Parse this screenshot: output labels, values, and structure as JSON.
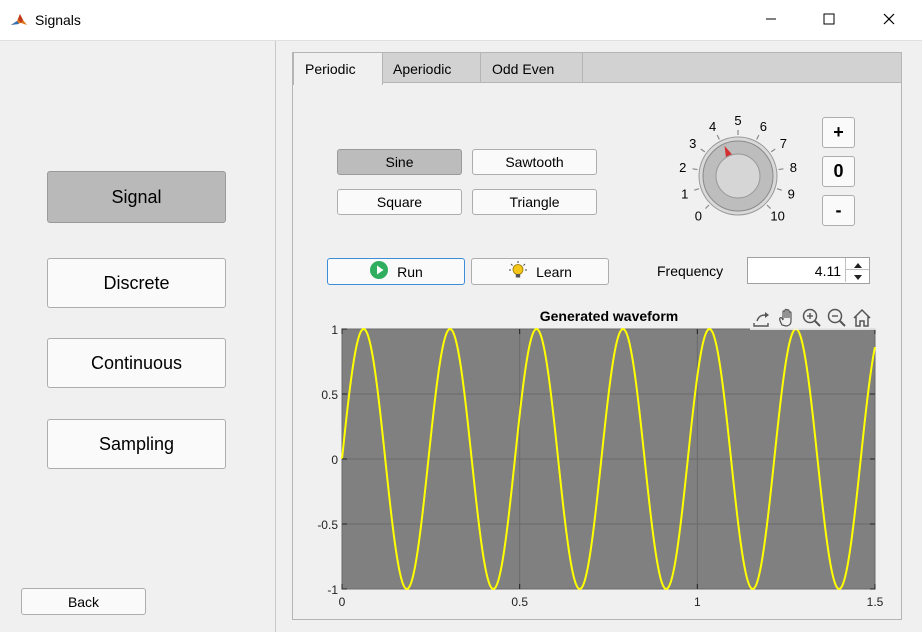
{
  "window": {
    "title": "Signals",
    "icon": "matlab-icon",
    "controls": [
      "minimize-icon",
      "maximize-icon",
      "close-icon"
    ]
  },
  "sidebar": {
    "items": [
      {
        "label": "Signal",
        "active": true
      },
      {
        "label": "Discrete",
        "active": false
      },
      {
        "label": "Continuous",
        "active": false
      },
      {
        "label": "Sampling",
        "active": false
      }
    ],
    "back_label": "Back"
  },
  "tabs": [
    {
      "label": "Periodic",
      "active": true
    },
    {
      "label": "Aperiodic",
      "active": false
    },
    {
      "label": "Odd Even",
      "active": false
    }
  ],
  "waveforms": [
    {
      "label": "Sine",
      "active": true
    },
    {
      "label": "Sawtooth",
      "active": false
    },
    {
      "label": "Square",
      "active": false
    },
    {
      "label": "Triangle",
      "active": false
    }
  ],
  "actions": {
    "run_label": "Run",
    "learn_label": "Learn"
  },
  "knob": {
    "labels": [
      "0",
      "1",
      "2",
      "3",
      "4",
      "5",
      "6",
      "7",
      "8",
      "9",
      "10"
    ],
    "value": 4.11,
    "pointer_color": "#d32f2f"
  },
  "stepper": {
    "plus": "+",
    "zero": "0",
    "minus": "-"
  },
  "frequency": {
    "label": "Frequency",
    "value": "4.11"
  },
  "axes_toolbar": [
    "export-icon",
    "pan-icon",
    "zoom-in-icon",
    "zoom-out-icon",
    "home-icon"
  ],
  "chart_data": {
    "type": "line",
    "title": "Generated waveform",
    "xlabel": "",
    "ylabel": "",
    "xlim": [
      0,
      1.5
    ],
    "ylim": [
      -1,
      1
    ],
    "xticks": [
      "0",
      "0.5",
      "1",
      "1.5"
    ],
    "yticks": [
      "-1",
      "-0.5",
      "0",
      "0.5",
      "1"
    ],
    "grid": true,
    "background": "#808080",
    "line_color": "#ffff00",
    "series": [
      {
        "function": "sin(2*pi*f*t)",
        "frequency": 4.11,
        "amplitude": 1,
        "t_start": 0,
        "t_end": 1.5
      }
    ]
  }
}
